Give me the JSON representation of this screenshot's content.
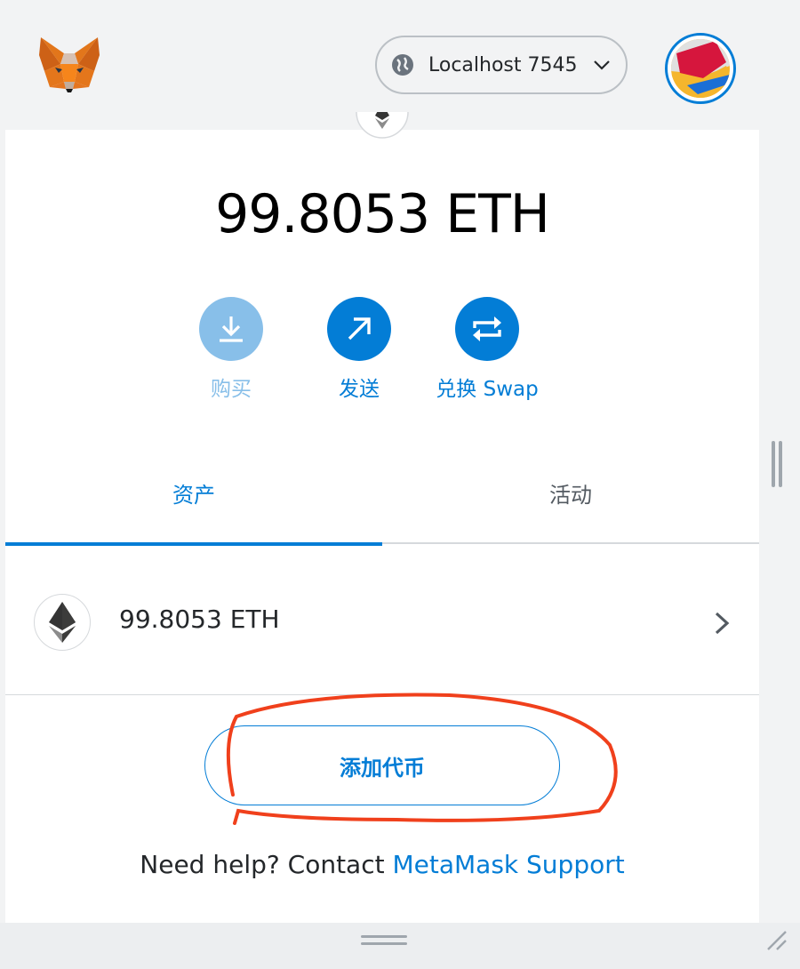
{
  "header": {
    "network_label": "Localhost 7545"
  },
  "balance": {
    "amount_text": "99.8053 ETH"
  },
  "actions": {
    "buy_label": "购买",
    "send_label": "发送",
    "swap_label": "兑换 Swap"
  },
  "tabs": {
    "assets_label": "资产",
    "activity_label": "活动"
  },
  "assets": [
    {
      "amount_text": "99.8053 ETH",
      "icon": "ethereum-icon"
    }
  ],
  "add_token_label": "添加代币",
  "help": {
    "prefix": "Need help? Contact ",
    "link_text": "MetaMask Support"
  },
  "colors": {
    "accent": "#037dd6",
    "accent_disabled": "#88bfe9",
    "annotation": "#f0401c",
    "background": "#f2f3f4"
  }
}
